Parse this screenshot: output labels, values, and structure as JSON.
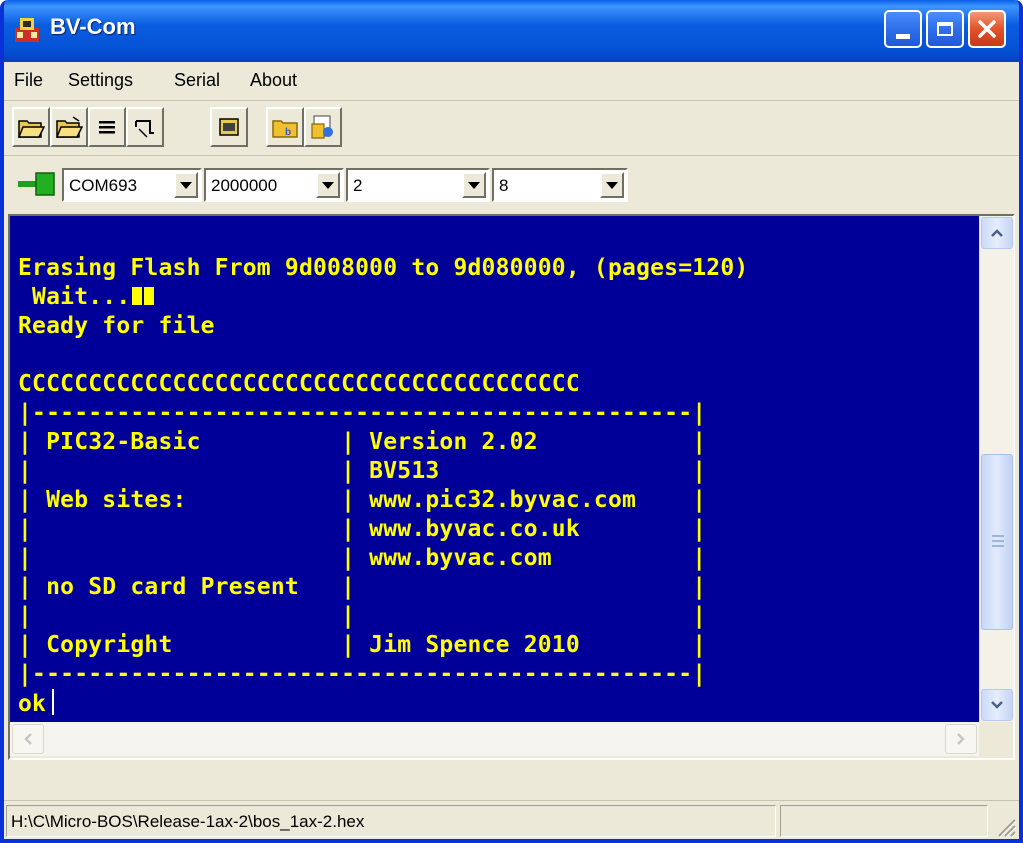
{
  "window": {
    "title": "BV-Com"
  },
  "menu": [
    {
      "label": "File"
    },
    {
      "label": "Settings"
    },
    {
      "label": "Serial"
    },
    {
      "label": "About"
    }
  ],
  "toolbar": {
    "icons": [
      "open-folder-icon",
      "open-folder-alt-icon",
      "list-icon",
      "cable-icon",
      "window-icon",
      "folder-b-icon",
      "folder-page-icon"
    ]
  },
  "connection": {
    "port": "COM693",
    "baud": "2000000",
    "stop_bits": "2",
    "data_bits": "8",
    "status_icon": "plug-connect-icon"
  },
  "terminal": {
    "background": "#000099",
    "text_color": "#ffff00",
    "lines": [
      "Erasing Flash From 9d008000 to 9d080000, (pages=120)",
      " Wait...",
      "Ready for file",
      "",
      "CCCCCCCCCCCCCCCCCCCCCCCCCCCCCCCCCCCCCCCC",
      "|-----------------------------------------------|",
      "| PIC32-Basic          | Version 2.02           |",
      "|                      | BV513                  |",
      "| Web sites:           | www.pic32.byvac.com    |",
      "|                      | www.byvac.co.uk        |",
      "|                      | www.byvac.com          |",
      "| no SD card Present   |                        |",
      "|                      |                        |",
      "| Copyright            | Jim Spence 2010        |",
      "|-----------------------------------------------|"
    ],
    "prompt": "ok"
  },
  "scrollbar": {
    "vertical_position": 0.78
  },
  "status": {
    "file_path": "H:\\C\\Micro-BOS\\Release-1ax-2\\bos_1ax-2.hex",
    "panel2": ""
  }
}
